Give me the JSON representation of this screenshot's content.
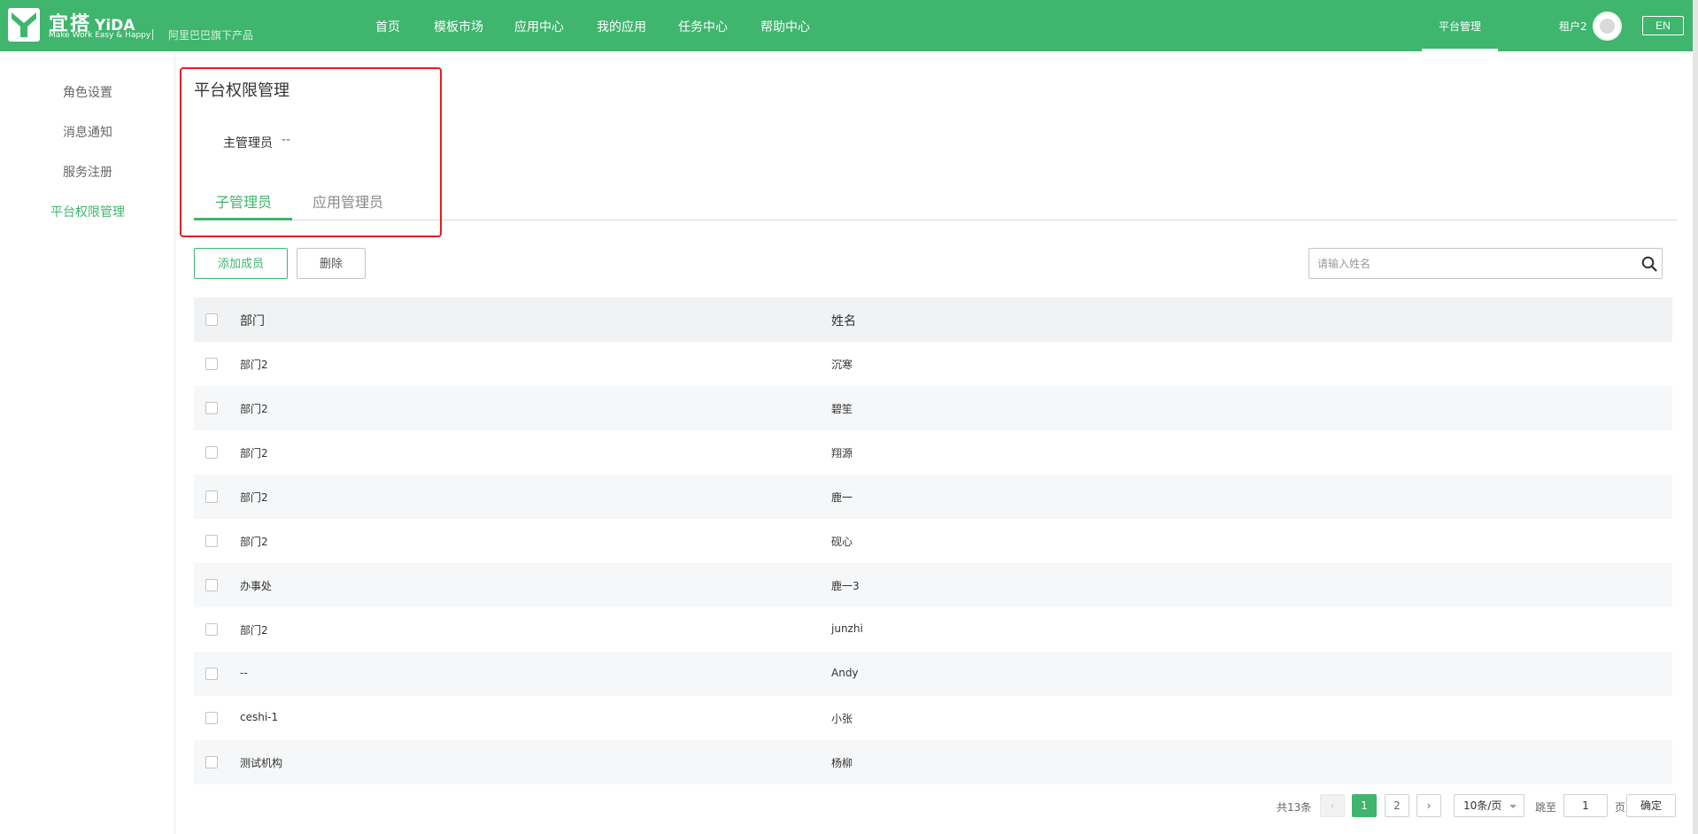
{
  "header": {
    "logo_title": "宜搭",
    "logo_title_en": "YiDA",
    "logo_tagline": "Make Work Easy & Happy",
    "logo_sub": "阿里巴巴旗下产品",
    "nav": [
      "首页",
      "模板市场",
      "应用中心",
      "我的应用",
      "任务中心",
      "帮助中心"
    ],
    "platform_admin": "平台管理",
    "tenant": "租户2",
    "lang": "EN",
    "brand_color": "#3fb56e"
  },
  "sidebar": {
    "items": [
      "角色设置",
      "消息通知",
      "服务注册",
      "平台权限管理"
    ],
    "active_index": 3
  },
  "main": {
    "title": "平台权限管理",
    "owner_label": "主管理员",
    "owner_value": "--",
    "tabs": [
      "子管理员",
      "应用管理员"
    ],
    "active_tab": 0,
    "add_button": "添加成员",
    "delete_button": "删除",
    "search_placeholder": "请输入姓名"
  },
  "table": {
    "columns": [
      "部门",
      "姓名"
    ],
    "rows": [
      {
        "dept": "部门2",
        "name": "沉寒"
      },
      {
        "dept": "部门2",
        "name": "碧笙"
      },
      {
        "dept": "部门2",
        "name": "翔源"
      },
      {
        "dept": "部门2",
        "name": "鹿一"
      },
      {
        "dept": "部门2",
        "name": "砚心"
      },
      {
        "dept": "办事处",
        "name": "鹿一3"
      },
      {
        "dept": "部门2",
        "name": "junzhi"
      },
      {
        "dept": "--",
        "name": "Andy"
      },
      {
        "dept": "ceshi-1",
        "name": "小张"
      },
      {
        "dept": "测试机构",
        "name": "杨柳"
      }
    ]
  },
  "pagination": {
    "total_text": "共13条",
    "prev": "‹",
    "next": "›",
    "pages": [
      "1",
      "2"
    ],
    "current_page": 1,
    "page_size": "10条/页",
    "jump_label": "跳至",
    "jump_value": "1",
    "page_unit": "页",
    "confirm": "确定"
  }
}
